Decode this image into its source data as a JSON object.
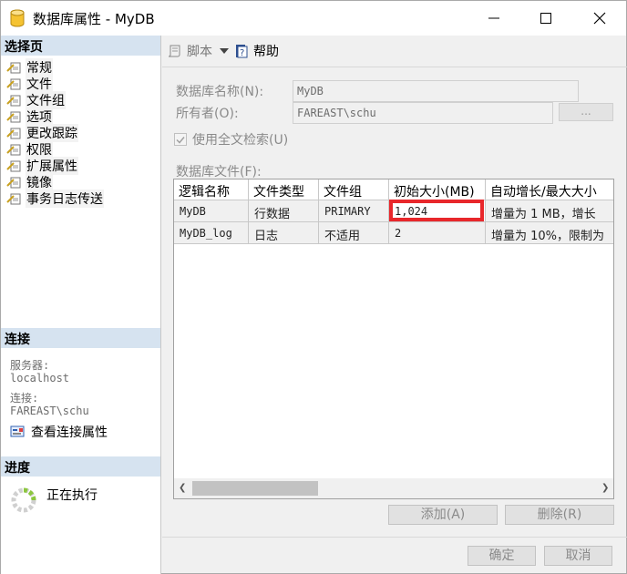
{
  "window": {
    "title": "数据库属性 - MyDB"
  },
  "left": {
    "select_page_header": "选择页",
    "pages": [
      "常规",
      "文件",
      "文件组",
      "选项",
      "更改跟踪",
      "权限",
      "扩展属性",
      "镜像",
      "事务日志传送"
    ],
    "connection_header": "连接",
    "server_label": "服务器:",
    "server_value": "localhost",
    "connection_label": "连接:",
    "connection_value": "FAREAST\\schu",
    "view_connection_link": "查看连接属性",
    "progress_header": "进度",
    "progress_status": "正在执行"
  },
  "toolbar": {
    "script": "脚本",
    "help": "帮助"
  },
  "form": {
    "db_name_label": "数据库名称(N):",
    "db_name_value": "MyDB",
    "owner_label": "所有者(O):",
    "owner_value": "FAREAST\\schu",
    "owner_button": "...",
    "fulltext_label": "使用全文检索(U)",
    "fulltext_checked": true,
    "db_files_label": "数据库文件(F):"
  },
  "grid": {
    "columns": [
      "逻辑名称",
      "文件类型",
      "文件组",
      "初始大小(MB)",
      "自动增长/最大大小"
    ],
    "rows": [
      [
        "MyDB",
        "行数据",
        "PRIMARY",
        "1,024",
        "增量为 1 MB，增长"
      ],
      [
        "MyDB_log",
        "日志",
        "不适用",
        "2",
        "增量为 10%，限制为"
      ]
    ]
  },
  "buttons": {
    "add": "添加(A)",
    "remove": "删除(R)",
    "ok": "确定",
    "cancel": "取消"
  },
  "colors": {
    "highlight": "#e8272b",
    "section_header": "#d6e3f0"
  }
}
